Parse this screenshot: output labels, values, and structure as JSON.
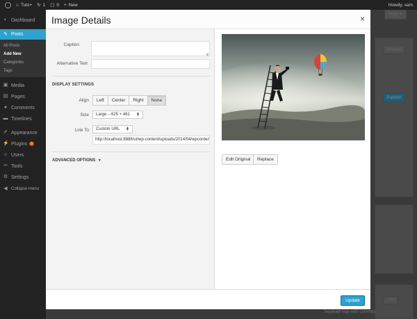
{
  "admin_bar": {
    "site_name": "Tuts+",
    "updates_count": "1",
    "comments_count": "0",
    "new_label": "New",
    "howdy": "Howdy, sam"
  },
  "sidebar": {
    "items": [
      {
        "label": "Dashboard",
        "icon": "dashboard-icon"
      },
      {
        "label": "Posts",
        "icon": "pin-icon"
      },
      {
        "label": "Media",
        "icon": "media-icon"
      },
      {
        "label": "Pages",
        "icon": "pages-icon"
      },
      {
        "label": "Comments",
        "icon": "comments-icon"
      },
      {
        "label": "Timelines",
        "icon": "timeline-icon"
      },
      {
        "label": "Appearance",
        "icon": "brush-icon"
      },
      {
        "label": "Plugins",
        "icon": "plug-icon",
        "badge": "0"
      },
      {
        "label": "Users",
        "icon": "users-icon"
      },
      {
        "label": "Tools",
        "icon": "wrench-icon"
      },
      {
        "label": "Settings",
        "icon": "settings-icon"
      },
      {
        "label": "Collapse menu",
        "icon": "collapse-icon"
      }
    ],
    "posts_submenu": [
      "All Posts",
      "Add New",
      "Categories",
      "Tags"
    ]
  },
  "background": {
    "help_label": "Help",
    "preview_label": "Preview",
    "publish_label": "Publish",
    "add_label": "Add",
    "bottom_text": "Separate tags with commas"
  },
  "modal": {
    "title": "Image Details",
    "close_label": "×",
    "fields": {
      "caption_label": "Caption",
      "caption_value": "",
      "alt_label": "Alternative Text",
      "alt_value": ""
    },
    "display_settings": {
      "title": "DISPLAY SETTINGS",
      "align_label": "Align",
      "align_options": [
        "Left",
        "Center",
        "Right",
        "None"
      ],
      "align_selected": "None",
      "size_label": "Size",
      "size_value": "Large – 625 × 461",
      "link_label": "Link To",
      "link_value": "Custom URL",
      "link_url": "http://localhost:8888/ut/wp-content/uploads/2014/04/wpcontent"
    },
    "advanced_label": "ADVANCED OPTIONS",
    "advanced_arrow": "▼",
    "edit_original_label": "Edit Original",
    "replace_label": "Replace",
    "update_label": "Update"
  },
  "colors": {
    "accent": "#2ea2cc",
    "admin_bar": "#222222",
    "modal_bg": "#fcfcfc",
    "pane_bg": "#f3f3f3"
  }
}
